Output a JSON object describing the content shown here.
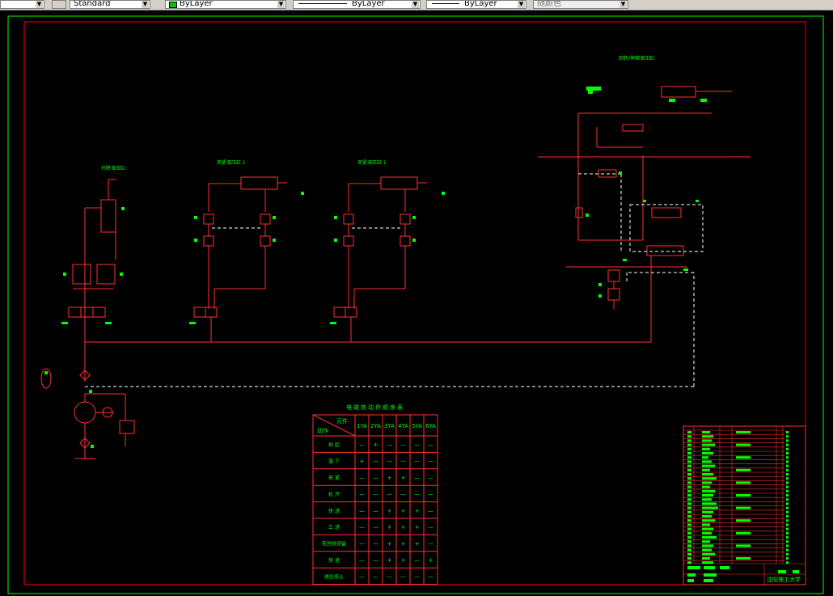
{
  "toolbar": {
    "textstyle": "Standard",
    "layer_color": "ByLayer",
    "linetype": "ByLayer",
    "lineweight": "ByLayer",
    "plotstyle": "随颜色"
  },
  "drawing": {
    "labels": {
      "lift_cylinder": "升降液压缸",
      "clamp_cylinder_1": "夹紧液压缸 1",
      "clamp_cylinder_2": "夹紧液压缸 1",
      "turn_cylinder": "回转/伸缩液压缸",
      "table_title": "电磁铁动作顺序表"
    },
    "table": {
      "header_element": "元件",
      "header_action": "动作",
      "columns": [
        "1YA",
        "2YA",
        "3YA",
        "4YA",
        "5YA",
        "6YA"
      ],
      "rows": [
        {
          "label": "抬 起",
          "cells": [
            "—",
            "+",
            "—",
            "—",
            "—",
            "—"
          ]
        },
        {
          "label": "落 下",
          "cells": [
            "+",
            "—",
            "—",
            "—",
            "—",
            "—"
          ]
        },
        {
          "label": "夹 紧",
          "cells": [
            "—",
            "—",
            "+",
            "+",
            "—",
            "—"
          ]
        },
        {
          "label": "松 开",
          "cells": [
            "—",
            "—",
            "—",
            "—",
            "—",
            "—"
          ]
        },
        {
          "label": "快 进",
          "cells": [
            "—",
            "—",
            "+",
            "+",
            "+",
            "—"
          ]
        },
        {
          "label": "工 进",
          "cells": [
            "—",
            "—",
            "+",
            "+",
            "+",
            "—"
          ]
        },
        {
          "label": "死挡铁停留",
          "cells": [
            "—",
            "—",
            "+",
            "+",
            "+",
            "—"
          ]
        },
        {
          "label": "快 退",
          "cells": [
            "—",
            "—",
            "+",
            "+",
            "—",
            "+"
          ]
        },
        {
          "label": "原位停止",
          "cells": [
            "—",
            "—",
            "—",
            "—",
            "—",
            "—"
          ]
        }
      ]
    },
    "title_block": {
      "school": "沈阳理工大学"
    }
  },
  "colors": {
    "frame": "#ff0000",
    "outer_frame": "#00ff00",
    "line": "#ff3030",
    "accent": "#00ff00",
    "dash": "#ffffff"
  }
}
